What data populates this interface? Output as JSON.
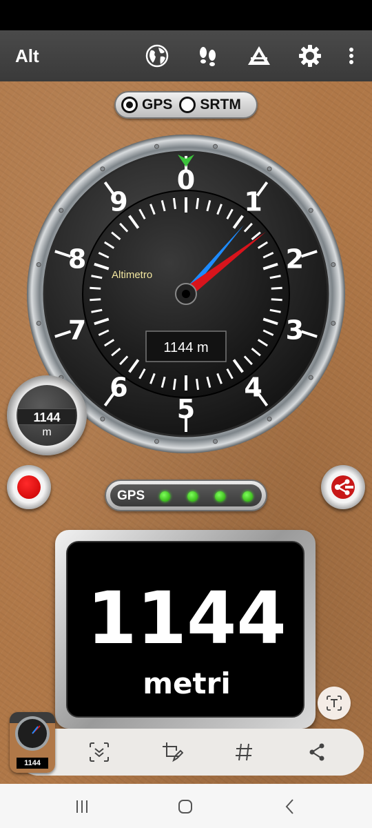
{
  "app_bar": {
    "title": "Alt",
    "icons": [
      "globe-icon",
      "footprints-icon",
      "triangle-icon",
      "gear-icon",
      "more-vert-icon"
    ]
  },
  "source_toggle": {
    "options": [
      {
        "label": "GPS",
        "selected": true
      },
      {
        "label": "SRTM",
        "selected": false
      }
    ]
  },
  "gauge": {
    "title": "Altimetro",
    "readout": "1144 m",
    "dial_numbers": [
      "0",
      "1",
      "2",
      "3",
      "4",
      "5",
      "6",
      "7",
      "8",
      "9"
    ],
    "altitude_m": 1144
  },
  "mini_gauge": {
    "value": "1144",
    "unit": "m"
  },
  "gps_status": {
    "label": "GPS",
    "leds": 4,
    "led_color": "#3ccf1a"
  },
  "display": {
    "value": "1144",
    "unit": "metri"
  },
  "capture_toolbar": {
    "thumbnail_label": "1144",
    "icons": [
      "scroll-capture-icon",
      "crop-edit-icon",
      "hashtag-icon",
      "share-icon"
    ]
  },
  "nav": {
    "icons": [
      "recents-icon",
      "home-icon",
      "back-icon"
    ]
  },
  "colors": {
    "leather": "#b07848",
    "app_bar": "#404040",
    "needle_red": "#d8141c",
    "needle_blue": "#1d8bff",
    "marker_green": "#3cc23c"
  }
}
